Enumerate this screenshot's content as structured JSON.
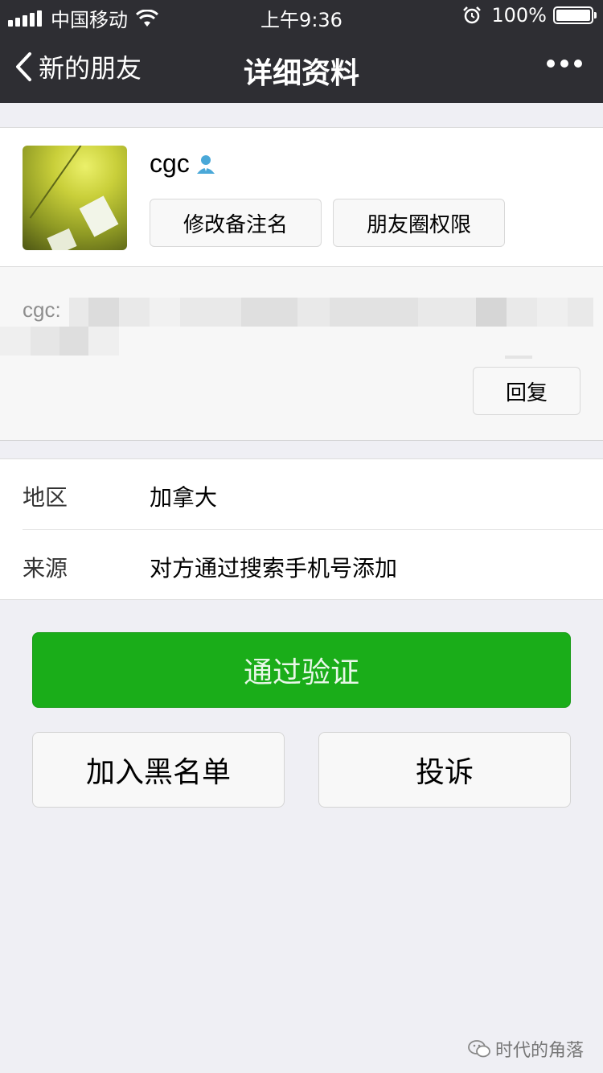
{
  "status_bar": {
    "carrier": "中国移动",
    "time": "上午9:36",
    "battery": "100%",
    "signal_icon": "signal-icon",
    "wifi_icon": "wifi-icon",
    "alarm_icon": "alarm-icon",
    "battery_icon": "battery-icon"
  },
  "nav": {
    "back_label": "新的朋友",
    "title": "详细资料",
    "more_icon": "more-icon"
  },
  "profile": {
    "name": "cgc",
    "verified_icon": "person-icon",
    "remark_button": "修改备注名",
    "moments_button": "朋友圈权限"
  },
  "message": {
    "sender_prefix": "cgc:",
    "reply_button": "回复"
  },
  "info": {
    "rows": [
      {
        "label": "地区",
        "value": "加拿大"
      },
      {
        "label": "来源",
        "value": "对方通过搜索手机号添加"
      }
    ]
  },
  "actions": {
    "verify_button": "通过验证",
    "blacklist_button": "加入黑名单",
    "report_button": "投诉"
  },
  "watermark": {
    "text": "时代的角落"
  },
  "colors": {
    "nav_bg": "#2e2e33",
    "page_bg": "#efeff4",
    "primary_green": "#1aad19",
    "verified_blue": "#4aa8d8"
  }
}
